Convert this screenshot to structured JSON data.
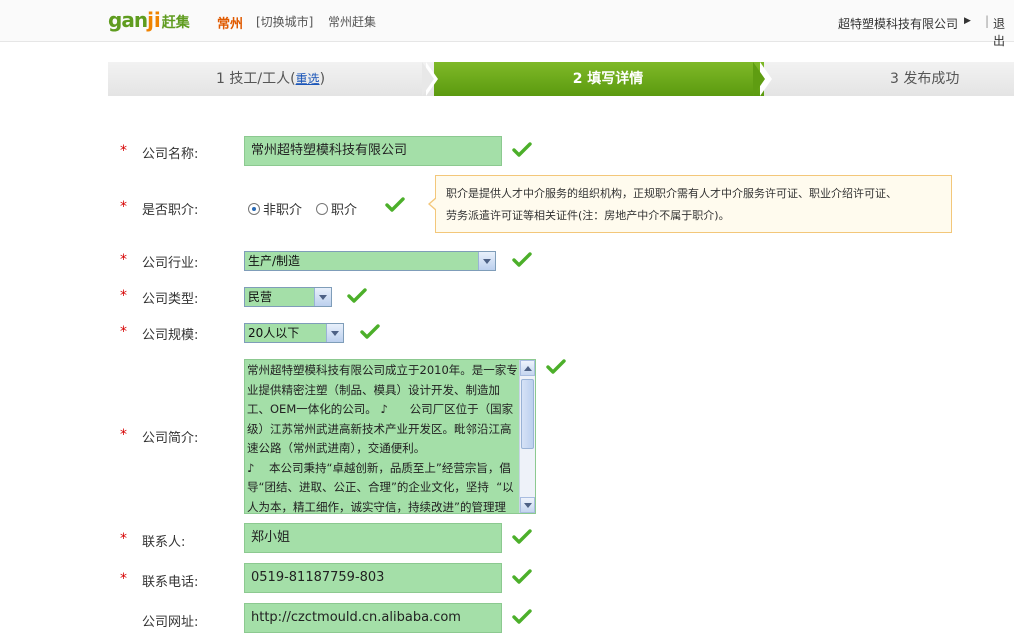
{
  "header": {
    "logo_main": "gan",
    "logo_mid": "ji",
    "logo_cn": "赶集",
    "city": "常州",
    "switch_city": "[切换城市]",
    "city_site": "常州赶集",
    "company": "超特塑模科技有限公司",
    "separator": "|",
    "logout": "退出"
  },
  "steps": {
    "step1_prefix": "1 技工/工人(",
    "step1_link": "重选",
    "step1_suffix": ")",
    "step2": "2  填写详情",
    "step3": "3 发布成功"
  },
  "form": {
    "required_mark": "*",
    "company_name": {
      "label": "公司名称:",
      "value": "常州超特塑模科技有限公司"
    },
    "is_agency": {
      "label": "是否职介:",
      "option_no": "非职介",
      "option_yes": "职介",
      "selected": "非职介"
    },
    "tip": {
      "line1": "职介是提供人才中介服务的组织机构，正规职介需有人才中介服务许可证、职业介绍许可证、",
      "line2": "劳务派遣许可证等相关证件(注：房地产中介不属于职介)。"
    },
    "industry": {
      "label": "公司行业:",
      "value": "生产/制造"
    },
    "type": {
      "label": "公司类型:",
      "value": "民营"
    },
    "scale": {
      "label": "公司规模:",
      "value": "20人以下"
    },
    "intro": {
      "label": "公司简介:",
      "value": "常州超特塑模科技有限公司成立于2010年。是一家专业提供精密注塑（制品、模具）设计开发、制造加工、OEM一体化的公司。 ♪      公司厂区位于（国家级）江苏常州武进高新技术产业开发区。毗邻沿江高速公路（常州武进南），交通便利。\n♪    本公司秉持“卓越创新，品质至上”经营宗旨，倡导“团结、进取、公正、合理”的企业文化，坚持  “以人为本，精工细作，诚实守信，持续改进”的管理理念，始终为所有客户持续提供高技"
    },
    "contact": {
      "label": "联系人:",
      "value": "郑小姐"
    },
    "phone": {
      "label": "联系电话:",
      "value": "0519-81187759-803"
    },
    "website": {
      "label": "公司网址:",
      "value": "http://czctmould.cn.alibaba.com"
    }
  },
  "colors": {
    "brand_green": "#5f9c1f",
    "brand_orange": "#f08300",
    "field_bg": "#a4dfa8",
    "check_green": "#4caf2a",
    "required_red": "#d60000"
  },
  "icons": [
    "check-icon",
    "radio-icon",
    "dropdown-arrow-icon",
    "scroll-up-icon",
    "scroll-down-icon",
    "user-menu-arrow-icon"
  ]
}
